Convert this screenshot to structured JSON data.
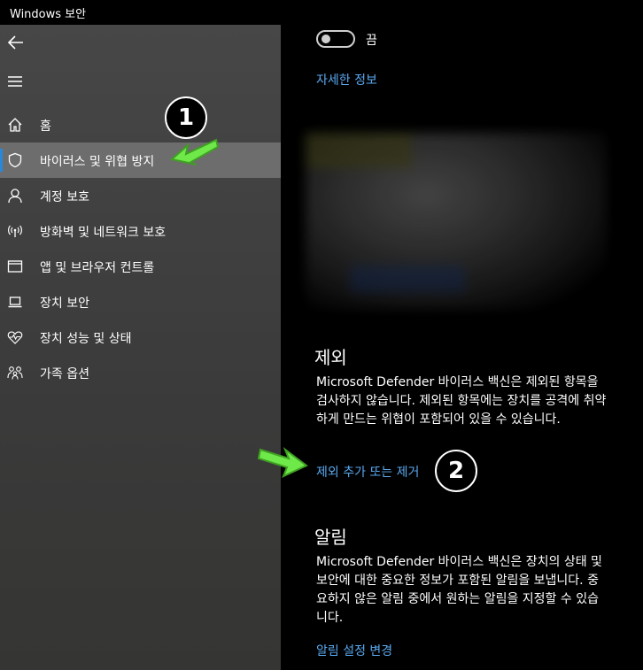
{
  "window": {
    "title": "Windows 보안"
  },
  "sidebar": {
    "back_icon": "back-arrow-icon",
    "menu_icon": "hamburger-menu-icon",
    "items": [
      {
        "label": "홈",
        "icon": "home-icon",
        "active": false
      },
      {
        "label": "바이러스 및 위협 방지",
        "icon": "shield-icon",
        "active": true
      },
      {
        "label": "계정 보호",
        "icon": "person-icon",
        "active": false
      },
      {
        "label": "방화벽 및 네트워크 보호",
        "icon": "wifi-signal-icon",
        "active": false
      },
      {
        "label": "앱 및 브라우저 컨트롤",
        "icon": "browser-window-icon",
        "active": false
      },
      {
        "label": "장치 보안",
        "icon": "laptop-icon",
        "active": false
      },
      {
        "label": "장치 성능 및 상태",
        "icon": "heart-pulse-icon",
        "active": false
      },
      {
        "label": "가족 옵션",
        "icon": "family-icon",
        "active": false
      }
    ]
  },
  "main": {
    "toggle": {
      "label": "끔",
      "state": "off"
    },
    "details_link": "자세한 정보",
    "exclusions": {
      "heading": "제외",
      "description": "Microsoft Defender 바이러스 백신은 제외된 항목을 검사하지 않습니다. 제외된 항목에는 장치를 공격에 취약하게 만드는 위협이 포함되어 있을 수 있습니다.",
      "link": "제외 추가 또는 제거"
    },
    "notifications": {
      "heading": "알림",
      "description": "Microsoft Defender 바이러스 백신은 장치의 상태 및 보안에 대한 중요한 정보가 포함된 알림을 보냅니다. 중요하지 않은 알림 중에서 원하는 알림을 지정할 수 있습니다.",
      "link": "알림 설정 변경"
    }
  },
  "annotations": {
    "badge1": "1",
    "badge2": "2"
  },
  "colors": {
    "accent": "#2b88d8",
    "link": "#5aa9f0",
    "annotation_arrow": "#6fe84a"
  }
}
